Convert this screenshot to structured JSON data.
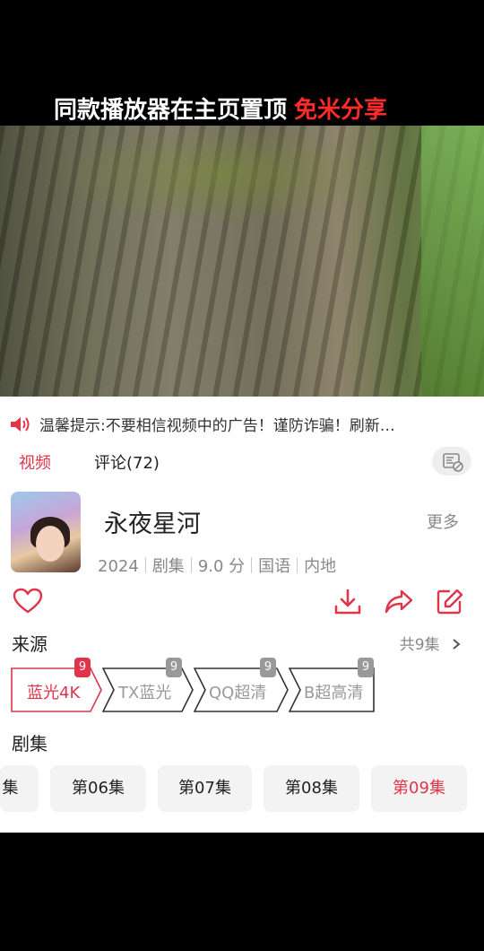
{
  "banner": {
    "text": "同款播放器在主页置顶",
    "highlight": "免米分享"
  },
  "notice": {
    "icon": "speaker-icon",
    "text": "温馨提示:不要相信视频中的广告！谨防诈骗！刷新…"
  },
  "tabs": {
    "video": "视频",
    "comments": "评论(72)"
  },
  "show": {
    "title": "永夜星河",
    "more_label": "更多",
    "meta": [
      "2024",
      "剧集",
      "9.0 分",
      "国语",
      "内地"
    ]
  },
  "actions": [
    "heart-icon",
    "download-icon",
    "share-icon",
    "edit-icon"
  ],
  "sources": {
    "label": "来源",
    "total": "共9集",
    "items": [
      {
        "label": "蓝光4K",
        "count": "9",
        "selected": true
      },
      {
        "label": "TX蓝光",
        "count": "9",
        "selected": false
      },
      {
        "label": "QQ超清",
        "count": "9",
        "selected": false
      },
      {
        "label": "B超高清",
        "count": "9",
        "selected": false
      }
    ]
  },
  "episodes": {
    "label": "剧集",
    "items": [
      "集",
      "第06集",
      "第07集",
      "第08集",
      "第09集"
    ],
    "active": "第09集"
  },
  "colors": {
    "accent": "#e0344a",
    "gray": "#999999"
  }
}
